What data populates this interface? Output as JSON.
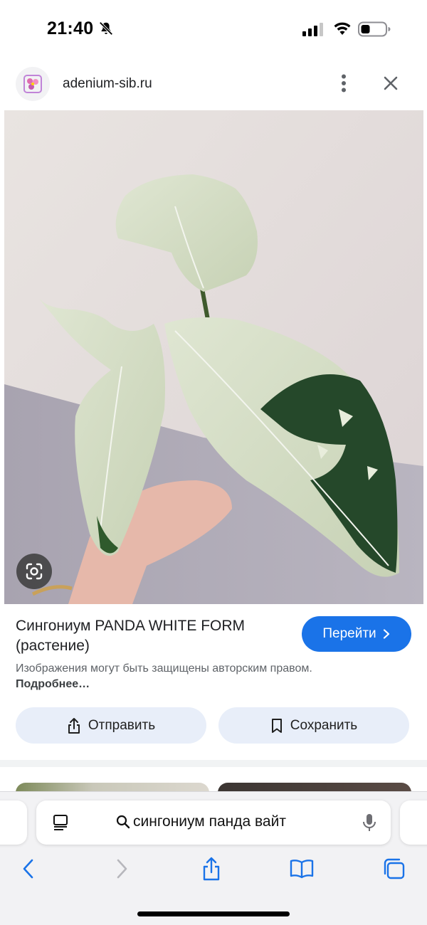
{
  "status_bar": {
    "time": "21:40",
    "icons": [
      "bell-slash-icon",
      "cellular-signal-icon",
      "wifi-icon",
      "battery-icon"
    ]
  },
  "header": {
    "domain": "adenium-sib.ru",
    "icons": [
      "site-favicon",
      "more-vert-icon",
      "close-icon"
    ]
  },
  "image": {
    "subject": "variegated syngonium plant held in hand",
    "lens_icon": "google-lens-icon"
  },
  "result": {
    "title": "Сингониум PANDA WHITE FORM (растение)",
    "visit_label": "Перейти",
    "copyright_text": "Изображения могут быть защищены авторским правом.",
    "more_link": "Подробнее…"
  },
  "actions": {
    "share_label": "Отправить",
    "save_label": "Сохранить"
  },
  "safari": {
    "address_text": "сингониум панда вайт",
    "icons": [
      "reader-icon",
      "search-icon",
      "mic-icon",
      "back-icon",
      "forward-icon",
      "share-icon",
      "bookmarks-icon",
      "tabs-icon"
    ]
  },
  "colors": {
    "accent": "#1a73e8",
    "button_bg": "#e8eef9",
    "toolbar_icon": "#1a73e8"
  }
}
